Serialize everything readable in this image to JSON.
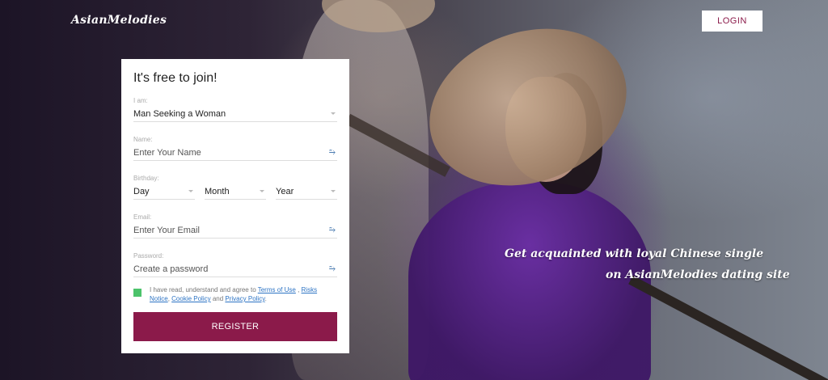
{
  "header": {
    "logo": "AsianMelodies",
    "login_label": "LOGIN"
  },
  "hero": {
    "tagline_line1": "Get acquainted with loyal Chinese single",
    "tagline_line2": "on AsianMelodies dating site"
  },
  "form": {
    "title": "It's free to join!",
    "i_am": {
      "label": "I am:",
      "value": "Man Seeking a Woman"
    },
    "name": {
      "label": "Name:",
      "placeholder": "Enter Your Name"
    },
    "birthday": {
      "label": "Birthday:",
      "day": "Day",
      "month": "Month",
      "year": "Year"
    },
    "email": {
      "label": "Email:",
      "placeholder": "Enter Your Email"
    },
    "password": {
      "label": "Password:",
      "placeholder": "Create a password"
    },
    "agree": {
      "prefix": "I have read, understand and agree to",
      "terms": "Terms of Use",
      "sep1": " , ",
      "risks": "Risks Notice",
      "sep2": ", ",
      "cookie": "Cookie Policy",
      "and": " and ",
      "privacy": "Privacy Policy",
      "suffix": "."
    },
    "register_label": "REGISTER"
  },
  "colors": {
    "brand": "#8b1a4a",
    "checkbox": "#4cc36b",
    "link": "#2d74c4"
  }
}
